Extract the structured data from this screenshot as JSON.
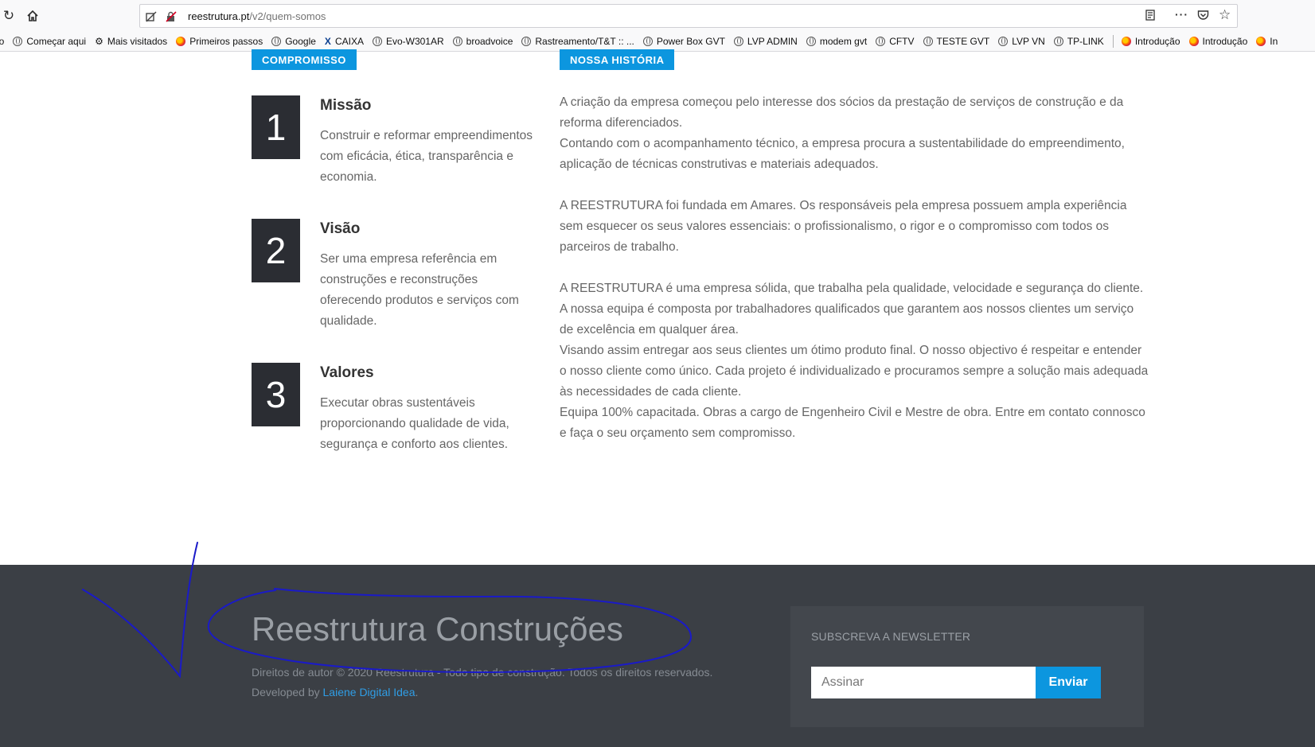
{
  "browser": {
    "url_host": "reestrutura.pt",
    "url_path": "/v2/quem-somos",
    "bookmarks": [
      {
        "label": "ção",
        "icon": "none"
      },
      {
        "label": "Começar aqui",
        "icon": "globe-icon"
      },
      {
        "label": "Mais visitados",
        "icon": "gear-icon"
      },
      {
        "label": "Primeiros passos",
        "icon": "firefox-icon"
      },
      {
        "label": "Google",
        "icon": "globe-icon"
      },
      {
        "label": "CAIXA",
        "icon": "caixa-icon"
      },
      {
        "label": "Evo-W301AR",
        "icon": "globe-icon"
      },
      {
        "label": "broadvoice",
        "icon": "globe-icon"
      },
      {
        "label": "Rastreamento/T&T :: ...",
        "icon": "globe-icon"
      },
      {
        "label": "Power Box GVT",
        "icon": "globe-icon"
      },
      {
        "label": "LVP ADMIN",
        "icon": "globe-icon"
      },
      {
        "label": "modem gvt",
        "icon": "globe-icon"
      },
      {
        "label": "CFTV",
        "icon": "globe-icon"
      },
      {
        "label": "TESTE GVT",
        "icon": "globe-icon"
      },
      {
        "label": "LVP VN",
        "icon": "globe-icon"
      },
      {
        "label": "TP-LINK",
        "icon": "globe-icon"
      },
      {
        "label": "Introdução",
        "icon": "firefox-icon"
      },
      {
        "label": "Introdução",
        "icon": "firefox-icon"
      },
      {
        "label": "In",
        "icon": "firefox-icon"
      }
    ]
  },
  "content": {
    "compromisso_label": "COMPROMISSO",
    "historia_label": "NOSSA HISTÓRIA",
    "items": [
      {
        "number": "1",
        "title": "Missão",
        "text": "Construir e reformar empreendimentos com eficácia, ética, transparência e economia."
      },
      {
        "number": "2",
        "title": "Visão",
        "text": "Ser uma empresa referência em construções e reconstruções oferecendo produtos e serviços com qualidade."
      },
      {
        "number": "3",
        "title": "Valores",
        "text": "Executar obras sustentáveis proporcionando qualidade de vida, segurança e conforto aos clientes."
      }
    ],
    "history": {
      "p1": "A criação da empresa começou pelo interesse dos sócios da prestação de serviços de construção e da reforma diferenciados.",
      "p2": "Contando com o acompanhamento técnico, a empresa procura a sustentabilidade do empreendimento, aplicação de técnicas construtivas e materiais adequados.",
      "p3": "A REESTRUTURA foi fundada em Amares. Os responsáveis pela empresa possuem ampla experiência sem esquecer os seus valores essenciais: o profissionalismo, o rigor e o compromisso com todos os parceiros de trabalho.",
      "p4": "A REESTRUTURA é uma empresa sólida, que trabalha pela qualidade, velocidade e segurança do cliente.",
      "p5": "A nossa equipa é composta por trabalhadores qualificados que garantem aos nossos clientes um serviço de excelência em qualquer área.",
      "p6": "Visando assim entregar aos seus clientes um ótimo produto final. O nosso objectivo é respeitar e entender o nosso cliente como único. Cada projeto é individualizado e procuramos sempre a solução mais adequada às necessidades de cada cliente.",
      "p7": "Equipa 100% capacitada. Obras a cargo de Engenheiro Civil e Mestre de obra. Entre em contato connosco e faça o seu orçamento sem compromisso."
    }
  },
  "footer": {
    "brand": "Reestrutura Construções",
    "copyright": "Direitos de autor © 2020 Reestrutura - Todo tipo de construção. Todos os direitos reservados.",
    "developed_prefix": "Developed by ",
    "developer_link": "Laiene Digital Idea",
    "developed_suffix": ".",
    "newsletter_title": "SUBSCREVA A NEWSLETTER",
    "newsletter_placeholder": "Assinar",
    "newsletter_button": "Enviar"
  },
  "colors": {
    "accent": "#0c96df",
    "dark_box": "#2b2d33",
    "footer_bg": "#3b3f45",
    "annotation": "#1a1ac8"
  }
}
